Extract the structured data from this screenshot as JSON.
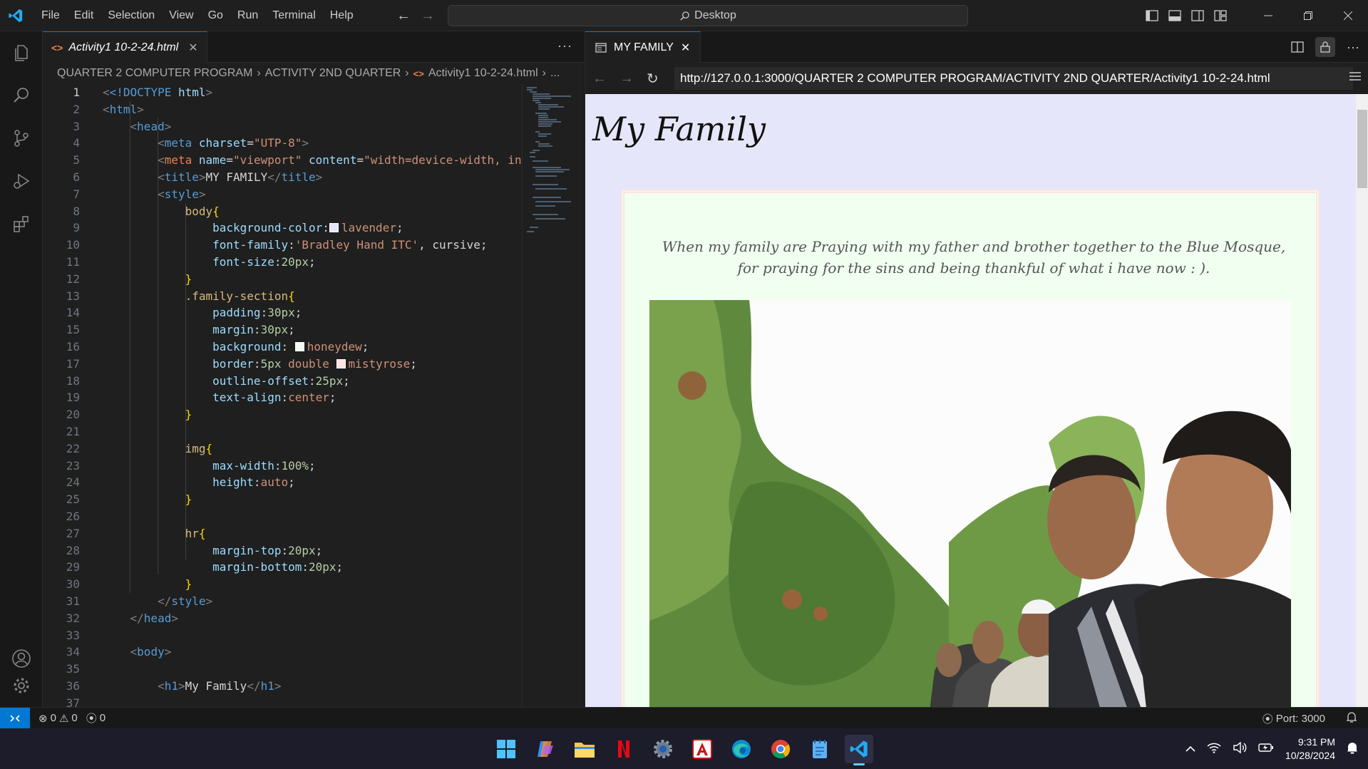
{
  "menu": [
    "File",
    "Edit",
    "Selection",
    "View",
    "Go",
    "Run",
    "Terminal",
    "Help"
  ],
  "command_center": "Desktop",
  "editor": {
    "tab_label": "Activity1 10-2-24.html",
    "breadcrumb": [
      "QUARTER 2 COMPUTER PROGRAM",
      "ACTIVITY 2ND QUARTER",
      "Activity1 10-2-24.html",
      "..."
    ],
    "line_numbers": [
      "1",
      "2",
      "3",
      "4",
      "5",
      "6",
      "7",
      "8",
      "9",
      "10",
      "11",
      "12",
      "13",
      "14",
      "15",
      "16",
      "17",
      "18",
      "19",
      "20",
      "21",
      "22",
      "23",
      "24",
      "25",
      "26",
      "27",
      "28",
      "29",
      "30",
      "31",
      "32",
      "33",
      "34",
      "35",
      "36",
      "37"
    ]
  },
  "code": {
    "l1_doctype": "<!DOCTYPE",
    "l1_html": "html",
    "l2": "html",
    "l3": "head",
    "l4_tag": "meta",
    "l4_attr": "charset",
    "l4_val": "\"UTP-8\"",
    "l5_tag": "meta",
    "l5_attr1": "name",
    "l5_val1": "\"viewport\"",
    "l5_attr2": "content",
    "l5_val2": "\"width=device-width, in",
    "l6_tag": "title",
    "l6_text": "MY FAMILY",
    "l7": "style",
    "l8_sel": "body",
    "l9_prop": "background-color",
    "l9_val": "lavender",
    "l10_prop": "font-family",
    "l10_val": "'Bradley Hand ITC'",
    "l10_rest": ", cursive;",
    "l11_prop": "font-size",
    "l11_val": "20px",
    "l13_sel": ".family-section",
    "l14_prop": "padding",
    "l14_val": "30px",
    "l15_prop": "margin",
    "l15_val": "30px",
    "l16_prop": "background",
    "l16_val": "honeydew",
    "l17_prop": "border",
    "l17_val1": "5px",
    "l17_val2": "double",
    "l17_val3": "mistyrose",
    "l18_prop": "outline-offset",
    "l18_val": "25px",
    "l19_prop": "text-align",
    "l19_val": "center",
    "l22_sel": "img",
    "l23_prop": "max-width",
    "l23_val": "100%",
    "l24_prop": "height",
    "l24_val": "auto",
    "l27_sel": "hr",
    "l28_prop": "margin-top",
    "l28_val": "20px",
    "l29_prop": "margin-bottom",
    "l29_val": "20px",
    "l31": "style",
    "l32": "head",
    "l34": "body",
    "l36_tag": "h1",
    "l36_text": "My Family"
  },
  "browser": {
    "tab_label": "MY FAMILY",
    "url": "http://127.0.0.1:3000/QUARTER 2 COMPUTER PROGRAM/ACTIVITY 2ND QUARTER/Activity1 10-2-24.html",
    "page_heading": "My Family",
    "caption": "When my family are Praying with my father and brother together to the Blue Mosque, for praying for the sins and being thankful of what i have now : )."
  },
  "status": {
    "errors": "0",
    "warnings": "0",
    "ports": "0",
    "port_label": "Port: 3000"
  },
  "taskbar": {
    "time": "9:31 PM",
    "date": "10/28/2024"
  },
  "colors": {
    "lavender": "#e6e6fa",
    "honeydew": "#f0fff0",
    "mistyrose": "#ffe4e1",
    "accent": "#0078d4"
  }
}
